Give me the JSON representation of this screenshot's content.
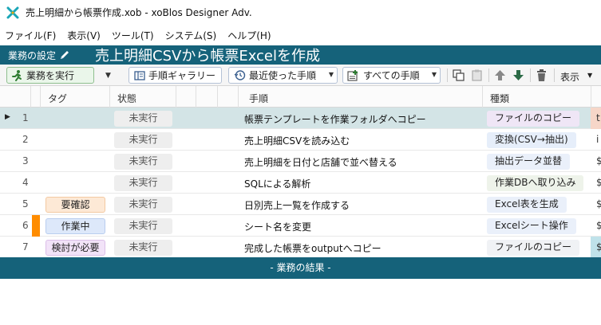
{
  "window": {
    "title": "売上明細から帳票作成.xob - xoBlos Designer Adv."
  },
  "menu": [
    "ファイル(F)",
    "表示(V)",
    "ツール(T)",
    "システム(S)",
    "ヘルプ(H)"
  ],
  "header": {
    "settings_label": "業務の設定",
    "doc_title": "売上明細CSVから帳票Excelを作成"
  },
  "toolbar": {
    "run_label": "業務を実行",
    "gallery_label": "手順ギャラリー",
    "recent_label": "最近使った手順",
    "all_label": "すべての手順",
    "display_label": "表示"
  },
  "grid": {
    "columns": [
      "タグ",
      "状態",
      "手順",
      "種類"
    ],
    "rows": [
      {
        "num": "1",
        "tag": "",
        "status": "未実行",
        "step": "帳票テンプレートを作業フォルダへコピー",
        "kind": "ファイルのコピー",
        "extra": "t"
      },
      {
        "num": "2",
        "tag": "",
        "status": "未実行",
        "step": "売上明細CSVを読み込む",
        "kind": "変換(CSV→抽出)",
        "extra": "i"
      },
      {
        "num": "3",
        "tag": "",
        "status": "未実行",
        "step": "売上明細を日付と店舗で並べ替える",
        "kind": "抽出データ並替",
        "extra": "$"
      },
      {
        "num": "4",
        "tag": "",
        "status": "未実行",
        "step": "SQLによる解析",
        "kind": "作業DBへ取り込み",
        "extra": "$"
      },
      {
        "num": "5",
        "tag": "要確認",
        "status": "未実行",
        "step": "日別売上一覧を作成する",
        "kind": "Excel表を生成",
        "extra": "$"
      },
      {
        "num": "6",
        "tag": "作業中",
        "status": "未実行",
        "step": "シート名を変更",
        "kind": "Excelシート操作",
        "extra": "$"
      },
      {
        "num": "7",
        "tag": "検討が必要",
        "status": "未実行",
        "step": "完成した帳票をoutputへコピー",
        "kind": "ファイルのコピー",
        "extra": "$"
      }
    ]
  },
  "result_band": "- 業務の結果 -",
  "colors": {
    "header_band": "#15627a",
    "selected_row": "#d3e4e6",
    "row6_marker": "#ff8c00",
    "tag_review": "#fde9d6",
    "tag_working": "#dde8fa",
    "tag_consider": "#f2e3f8"
  }
}
